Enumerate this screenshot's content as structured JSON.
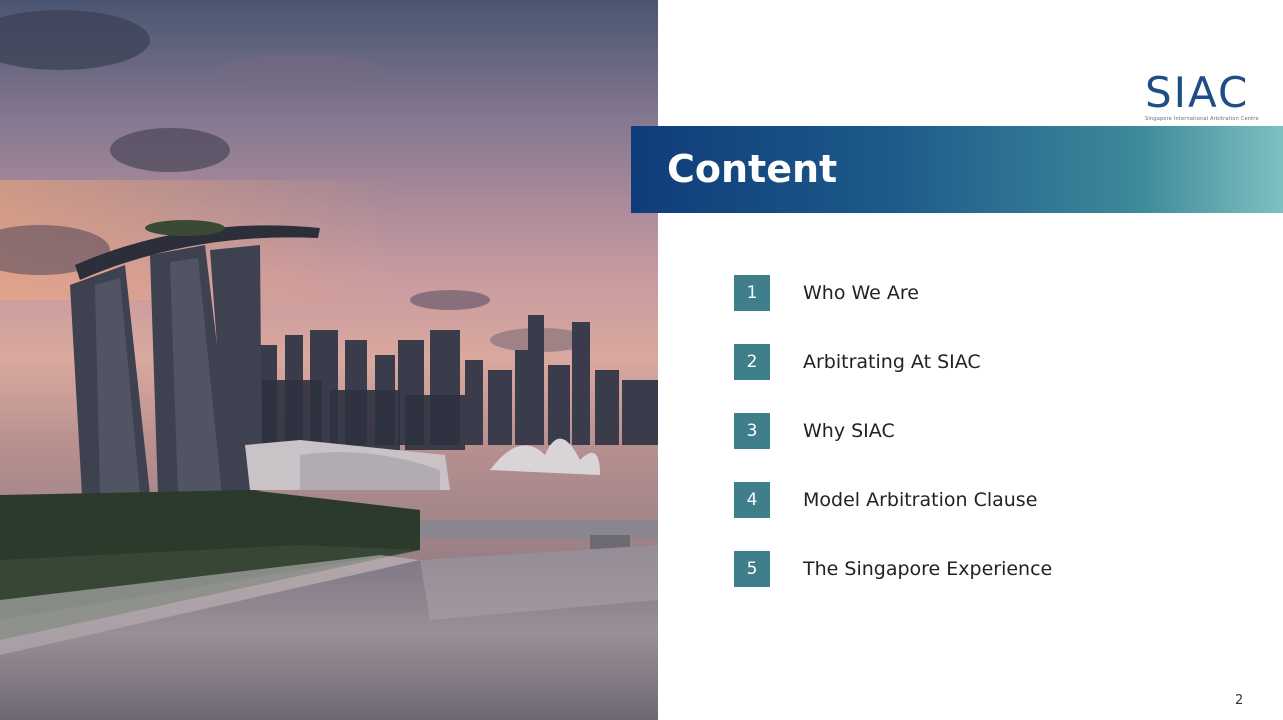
{
  "logo": {
    "text": "SIAC",
    "subtitle": "Singapore International Arbitration Centre"
  },
  "title": "Content",
  "agenda": [
    {
      "number": "1",
      "label": "Who We Are"
    },
    {
      "number": "2",
      "label": "Arbitrating At SIAC"
    },
    {
      "number": "3",
      "label": "Why SIAC"
    },
    {
      "number": "4",
      "label": "Model Arbitration Clause"
    },
    {
      "number": "5",
      "label": "The Singapore Experience"
    }
  ],
  "page_number": "2",
  "colors": {
    "banner_start": "#0f3c7a",
    "banner_end": "#7ec0c0",
    "number_box": "#3f7f8c",
    "logo": "#1d4e85"
  }
}
